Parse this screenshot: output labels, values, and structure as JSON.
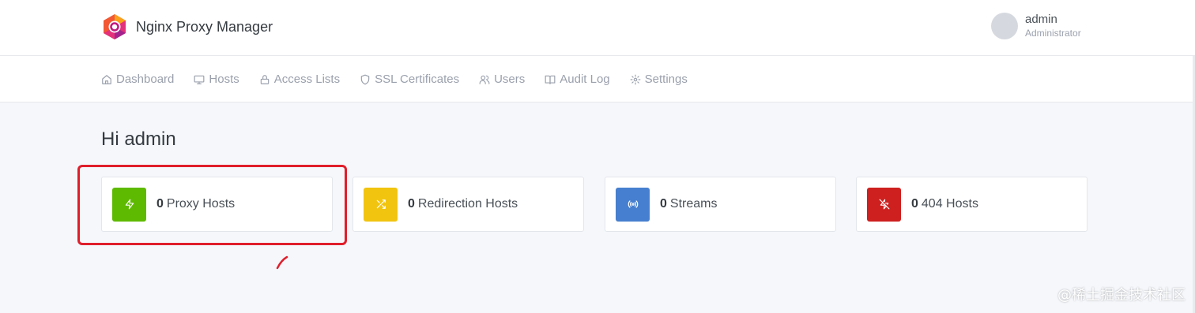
{
  "header": {
    "app_title": "Nginx Proxy Manager",
    "logo_icon": "nginx-proxy-manager-logo",
    "user": {
      "name": "admin",
      "role": "Administrator"
    }
  },
  "nav": {
    "items": [
      {
        "label": "Dashboard",
        "icon": "home-icon"
      },
      {
        "label": "Hosts",
        "icon": "monitor-icon"
      },
      {
        "label": "Access Lists",
        "icon": "lock-icon"
      },
      {
        "label": "SSL Certificates",
        "icon": "shield-icon"
      },
      {
        "label": "Users",
        "icon": "users-icon"
      },
      {
        "label": "Audit Log",
        "icon": "book-open-icon"
      },
      {
        "label": "Settings",
        "icon": "gear-icon"
      }
    ]
  },
  "main": {
    "greeting": "Hi admin",
    "cards": [
      {
        "count": "0",
        "label": "Proxy Hosts",
        "icon": "zap-icon",
        "color": "#5eba00"
      },
      {
        "count": "0",
        "label": "Redirection Hosts",
        "icon": "shuffle-icon",
        "color": "#f1c40f"
      },
      {
        "count": "0",
        "label": "Streams",
        "icon": "radio-icon",
        "color": "#467fcf"
      },
      {
        "count": "0",
        "label": "404 Hosts",
        "icon": "zap-off-icon",
        "color": "#cd201f"
      }
    ]
  },
  "annotation": {
    "highlight_color": "#e01e2b"
  },
  "watermark": "@稀土掘金技术社区"
}
